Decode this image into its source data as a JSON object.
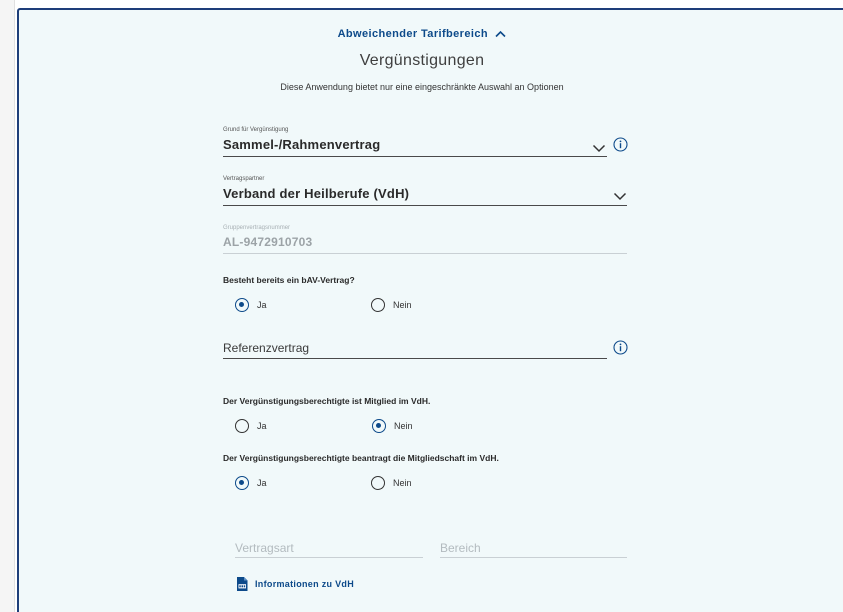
{
  "header": {
    "toggle_label": "Abweichender Tarifbereich",
    "title": "Vergünstigungen",
    "subtitle": "Diese Anwendung bietet nur eine eingeschränkte Auswahl an Optionen"
  },
  "grund": {
    "label": "Grund für Vergünstigung",
    "value": "Sammel-/Rahmenvertrag"
  },
  "partner": {
    "label": "Vertragspartner",
    "value": "Verband der Heilberufe (VdH)"
  },
  "gruppe": {
    "label": "Gruppenvertragsnummer",
    "value": "AL-9472910703"
  },
  "bav": {
    "question": "Besteht bereits ein bAV-Vertrag?",
    "options": [
      "Ja",
      "Nein"
    ],
    "selected": "Ja"
  },
  "referenz": {
    "placeholder": "Referenzvertrag"
  },
  "mitglied": {
    "question": "Der Vergünstigungsberechtigte ist Mitglied im VdH.",
    "options": [
      "Ja",
      "Nein"
    ],
    "selected": "Nein"
  },
  "beantragt": {
    "question": "Der Vergünstigungsberechtigte beantragt die Mitgliedschaft im VdH.",
    "options": [
      "Ja",
      "Nein"
    ],
    "selected": "Ja"
  },
  "vertragsart": {
    "placeholder": "Vertragsart"
  },
  "bereich": {
    "placeholder": "Bereich"
  },
  "info_link": {
    "label": "Informationen zu VdH",
    "icon": "pdf-icon"
  },
  "colors": {
    "accent": "#0d4a8a",
    "panel_bg": "#f1f9fa",
    "border": "#1e3e7a"
  }
}
